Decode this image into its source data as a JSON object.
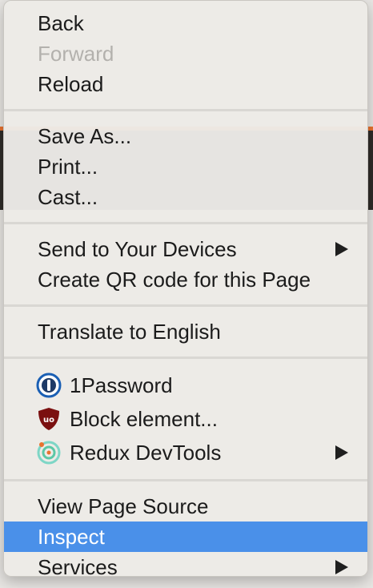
{
  "menu": {
    "groups": [
      [
        {
          "label": "Back",
          "disabled": false,
          "submenu": false
        },
        {
          "label": "Forward",
          "disabled": true,
          "submenu": false
        },
        {
          "label": "Reload",
          "disabled": false,
          "submenu": false
        }
      ],
      [
        {
          "label": "Save As...",
          "disabled": false,
          "submenu": false
        },
        {
          "label": "Print...",
          "disabled": false,
          "submenu": false
        },
        {
          "label": "Cast...",
          "disabled": false,
          "submenu": false
        }
      ],
      [
        {
          "label": "Send to Your Devices",
          "disabled": false,
          "submenu": true
        },
        {
          "label": "Create QR code for this Page",
          "disabled": false,
          "submenu": false
        }
      ],
      [
        {
          "label": "Translate to English",
          "disabled": false,
          "submenu": false
        }
      ],
      [
        {
          "label": "1Password",
          "icon": "onepassword-icon",
          "disabled": false,
          "submenu": false
        },
        {
          "label": "Block element...",
          "icon": "ublock-shield-icon",
          "disabled": false,
          "submenu": false
        },
        {
          "label": "Redux DevTools",
          "icon": "redux-devtools-icon",
          "disabled": false,
          "submenu": true
        }
      ],
      [
        {
          "label": "View Page Source",
          "disabled": false,
          "submenu": false
        },
        {
          "label": "Inspect",
          "disabled": false,
          "submenu": false,
          "selected": true
        },
        {
          "label": "Services",
          "disabled": false,
          "submenu": true
        }
      ]
    ]
  },
  "colors": {
    "selection": "#4a90e9",
    "disabled_text": "#b3b1ad",
    "text": "#1b1b1b"
  }
}
